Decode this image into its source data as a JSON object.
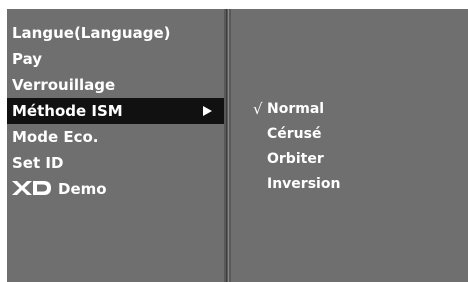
{
  "menu": {
    "items": [
      {
        "label": "Langue(Language)"
      },
      {
        "label": "Pay"
      },
      {
        "label": "Verrouillage"
      },
      {
        "label": "Méthode ISM",
        "selected": true
      },
      {
        "label": "Mode Eco."
      },
      {
        "label": "Set ID"
      },
      {
        "label": "Demo",
        "logo": "XD"
      }
    ],
    "arrow_icon": "triangle-right"
  },
  "submenu": {
    "check_mark": "√",
    "options": [
      {
        "label": "Normal",
        "checked": true
      },
      {
        "label": "Cérusé",
        "checked": false
      },
      {
        "label": "Orbiter",
        "checked": false
      },
      {
        "label": "Inversion",
        "checked": false
      }
    ]
  },
  "colors": {
    "panel_bg": "#6f6f6f",
    "highlight_bg": "#111111",
    "text": "#ffffff"
  }
}
